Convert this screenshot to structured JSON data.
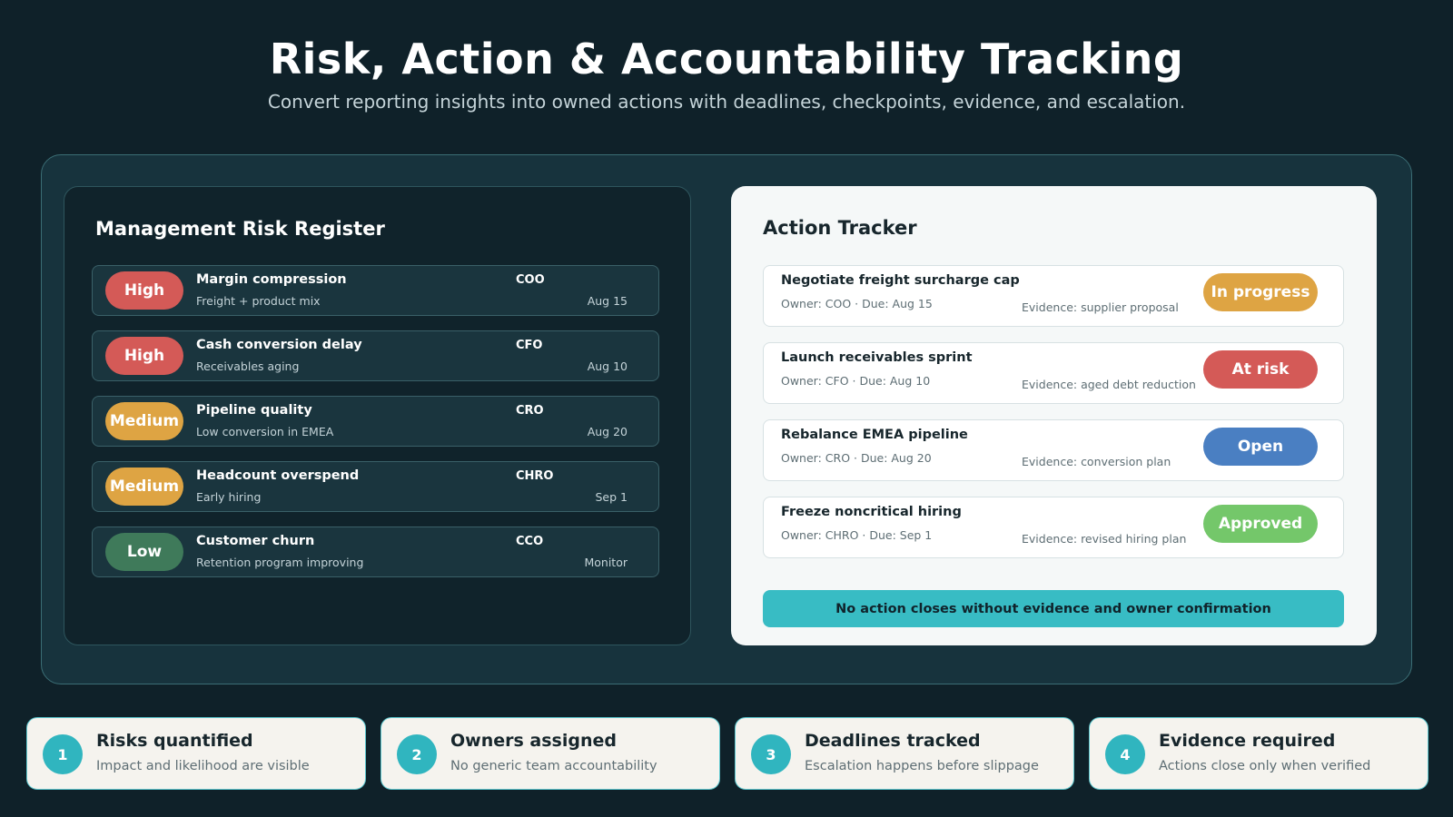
{
  "header": {
    "title": "Risk, Action & Accountability Tracking",
    "subtitle": "Convert reporting insights into owned actions with deadlines, checkpoints, evidence, and escalation."
  },
  "risk_register": {
    "title": "Management Risk Register",
    "rows": [
      {
        "severity": "High",
        "severity_color": "#d45a57",
        "name": "Margin compression",
        "desc": "Freight + product mix",
        "owner": "COO",
        "date": "Aug 15"
      },
      {
        "severity": "High",
        "severity_color": "#d45a57",
        "name": "Cash conversion delay",
        "desc": "Receivables aging",
        "owner": "CFO",
        "date": "Aug 10"
      },
      {
        "severity": "Medium",
        "severity_color": "#dea443",
        "name": "Pipeline quality",
        "desc": "Low conversion in EMEA",
        "owner": "CRO",
        "date": "Aug 20"
      },
      {
        "severity": "Medium",
        "severity_color": "#dea443",
        "name": "Headcount overspend",
        "desc": "Early hiring",
        "owner": "CHRO",
        "date": "Sep 1"
      },
      {
        "severity": "Low",
        "severity_color": "#3f7a5a",
        "name": "Customer churn",
        "desc": "Retention program improving",
        "owner": "CCO",
        "date": "Monitor"
      }
    ]
  },
  "action_tracker": {
    "title": "Action Tracker",
    "rows": [
      {
        "name": "Negotiate freight surcharge cap",
        "meta": "Owner: COO · Due: Aug 15",
        "evidence": "Evidence: supplier proposal",
        "status": "In progress",
        "status_color": "#dea443"
      },
      {
        "name": "Launch receivables sprint",
        "meta": "Owner: CFO · Due: Aug 10",
        "evidence": "Evidence: aged debt reduction",
        "status": "At risk",
        "status_color": "#d45a57"
      },
      {
        "name": "Rebalance EMEA pipeline",
        "meta": "Owner: CRO · Due: Aug 20",
        "evidence": "Evidence: conversion plan",
        "status": "Open",
        "status_color": "#4a7fc2"
      },
      {
        "name": "Freeze noncritical hiring",
        "meta": "Owner: CHRO · Due: Sep 1",
        "evidence": "Evidence: revised hiring plan",
        "status": "Approved",
        "status_color": "#74c76a"
      }
    ],
    "banner": "No action closes without evidence and owner confirmation"
  },
  "cards": [
    {
      "num": "1",
      "title": "Risks quantified",
      "desc": "Impact and likelihood are visible"
    },
    {
      "num": "2",
      "title": "Owners assigned",
      "desc": "No generic team accountability"
    },
    {
      "num": "3",
      "title": "Deadlines tracked",
      "desc": "Escalation happens before slippage"
    },
    {
      "num": "4",
      "title": "Evidence required",
      "desc": "Actions close only when verified"
    }
  ]
}
